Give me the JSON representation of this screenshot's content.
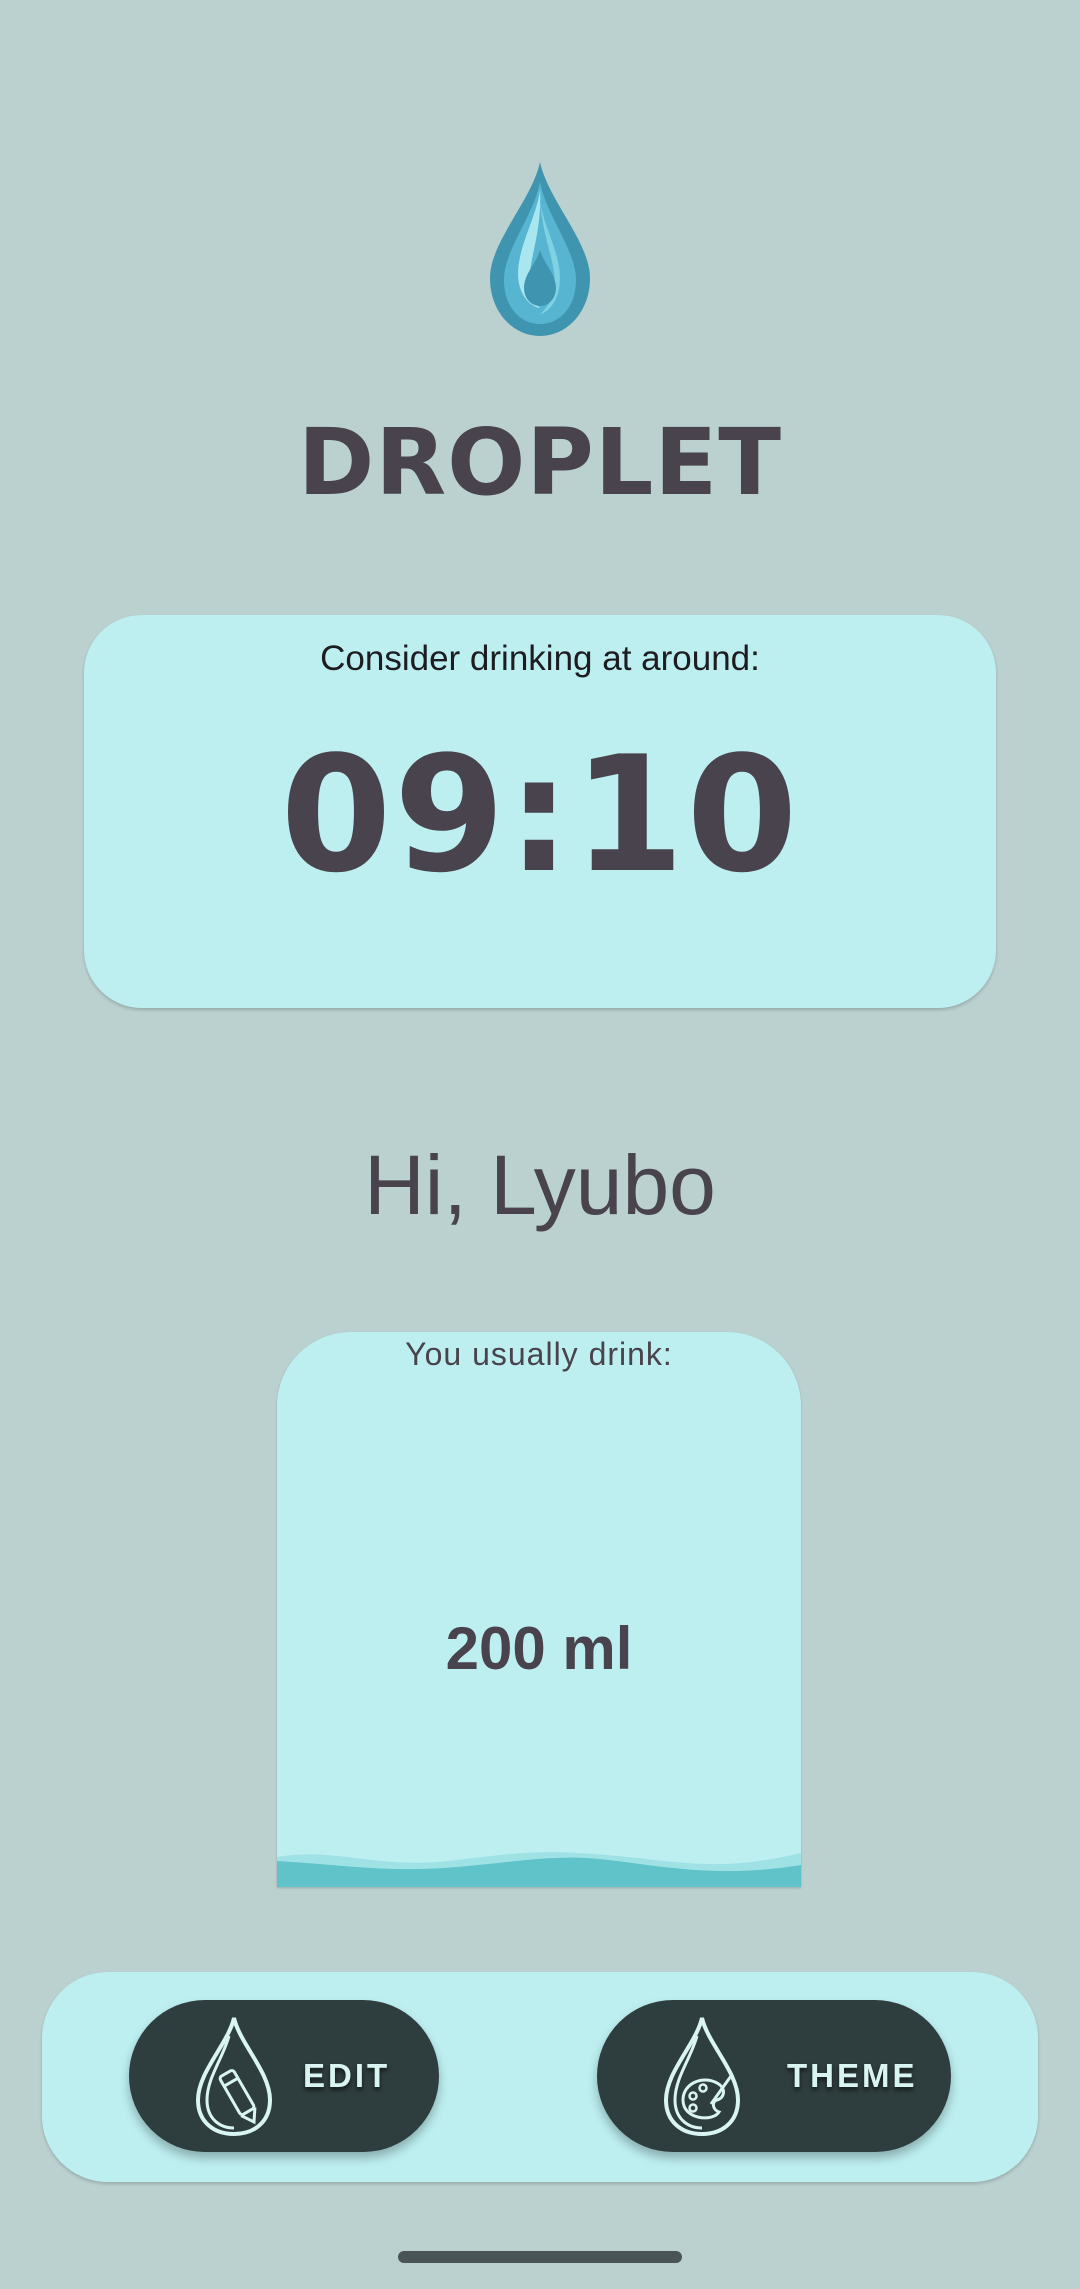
{
  "app": {
    "title": "DROPLET"
  },
  "reminder": {
    "label": "Consider drinking at around:",
    "time": "09:10"
  },
  "greeting": "Hi, Lyubo",
  "usual_amount": {
    "label": "You usually drink:",
    "value": "200 ml"
  },
  "actions": {
    "edit_label": "EDIT",
    "theme_label": "THEME"
  },
  "icons": {
    "logo": "water-drop-icon",
    "edit": "drop-pencil-icon",
    "theme": "drop-palette-icon"
  },
  "colors": {
    "background": "#bad1cf",
    "card": "#bdeff1",
    "text": "#48434c",
    "button": "#2e3d3d",
    "water": "#5fc3c9"
  }
}
